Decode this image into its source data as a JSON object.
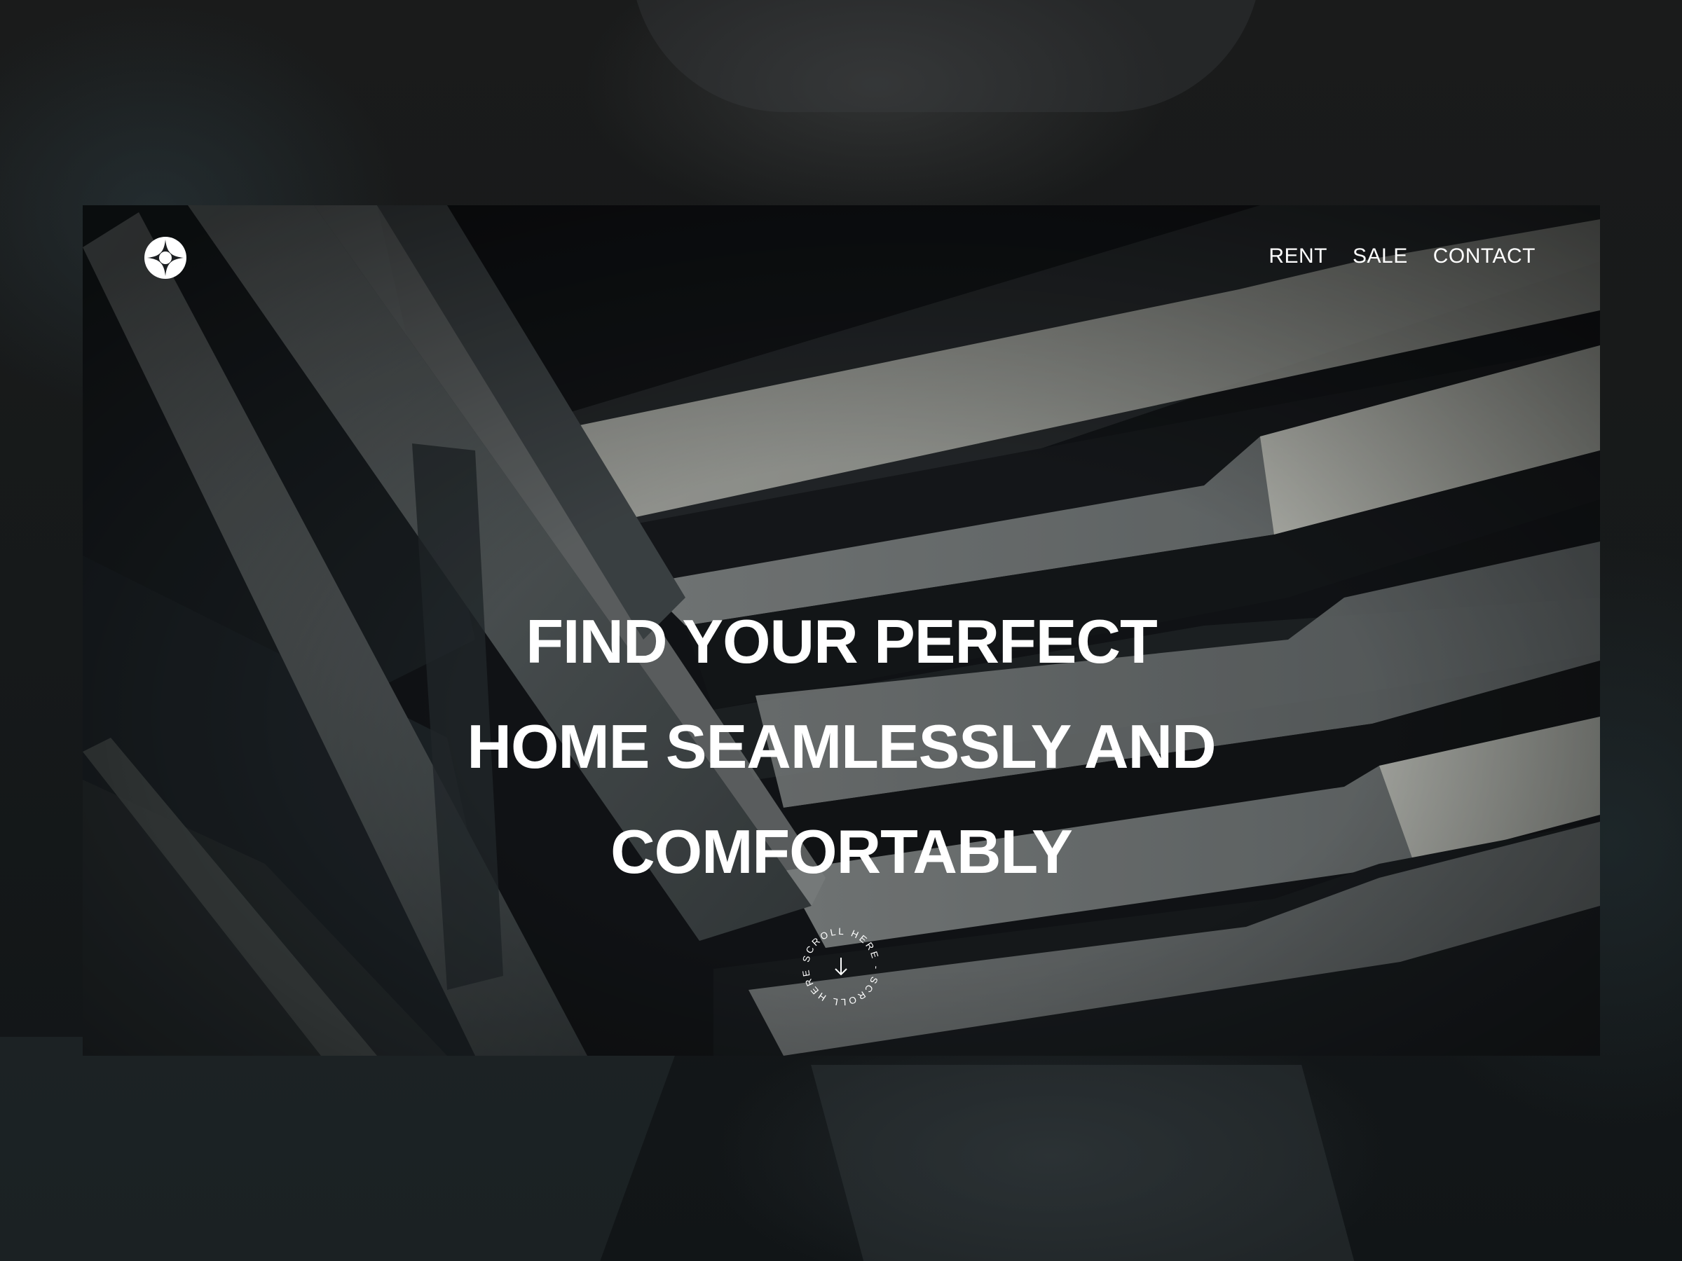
{
  "nav": {
    "items": [
      {
        "label": "RENT"
      },
      {
        "label": "SALE"
      },
      {
        "label": "CONTACT"
      }
    ]
  },
  "hero": {
    "headline_lines": [
      "FIND YOUR PERFECT",
      "HOME SEAMLESSLY AND",
      "COMFORTABLY"
    ]
  },
  "scroll_badge": {
    "ring_text": "SCROLL HERE - SCROLL HERE -",
    "icon": "arrow-down-icon"
  },
  "logo": {
    "icon": "star-circle-logo-icon"
  },
  "colors": {
    "text": "#ffffff",
    "page_background": "#141616",
    "hero_shadow": "#0e1012",
    "hero_steel": "#6f7677",
    "hero_light_panel": "#c9cbc3"
  }
}
